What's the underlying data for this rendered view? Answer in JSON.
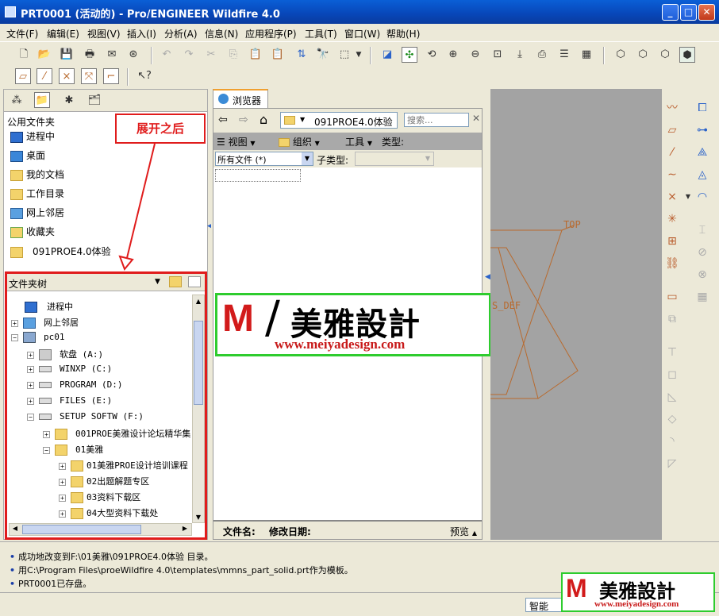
{
  "window": {
    "title": "PRT0001 (活动的) - Pro/ENGINEER Wildfire 4.0"
  },
  "menu": [
    "文件(F)",
    "编辑(E)",
    "视图(V)",
    "插入(I)",
    "分析(A)",
    "信息(N)",
    "应用程序(P)",
    "工具(T)",
    "窗口(W)",
    "帮助(H)"
  ],
  "nav": {
    "header": "公用文件夹",
    "items": [
      "进程中",
      "桌面",
      "我的文档",
      "工作目录",
      "网上邻居",
      "收藏夹",
      "091PROE4.0体验"
    ]
  },
  "annotation": "展开之后",
  "folder_tree": {
    "title": "文件夹树",
    "items": [
      "进程中",
      "网上邻居",
      "pc01",
      "软盘 (A:)",
      "WINXP (C:)",
      "PROGRAM (D:)",
      "FILES (E:)",
      "SETUP SOFTW (F:)",
      "001PROE美雅设计论坛精华集",
      "01美雅",
      "01美雅PROE设计培训课程",
      "02出题解题专区",
      "03资料下载区",
      "04大型资料下载处"
    ]
  },
  "browser": {
    "tab": "浏览器",
    "path": "091PROE4.0体验",
    "search_placeholder": "搜索...",
    "view": "视图",
    "organize": "组织",
    "tools": "工具",
    "type_label": "类型:",
    "filter": "所有文件 (*)",
    "subtype_label": "子类型:",
    "col_name": "文件名:",
    "col_date": "修改日期:",
    "preview": "预览"
  },
  "watermark": {
    "brand": "美雅設計",
    "url": "www.meiyadesign.com"
  },
  "model": {
    "top_label": "TOP",
    "def_label": "S_DEF"
  },
  "messages": [
    "成功地改变到F:\\01美雅\\091PROE4.0体验 目录。",
    "用C:\\Program Files\\proeWildfire 4.0\\templates\\mmns_part_solid.prt作为模板。",
    "PRT0001已存盘。"
  ],
  "status": {
    "filter": "智能"
  },
  "colors": {
    "title": "#0a5fd6",
    "annotation": "#e01c1c",
    "watermark_border": "#2ecc2e",
    "datum": "#b86a2e"
  }
}
